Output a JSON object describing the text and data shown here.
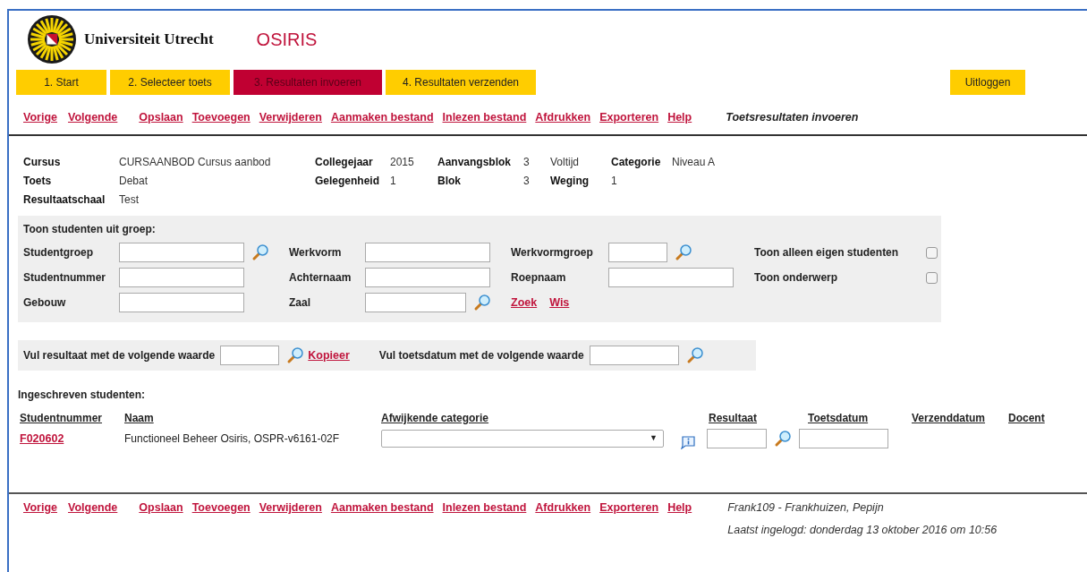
{
  "header": {
    "university": "Universiteit Utrecht",
    "app": "OSIRIS"
  },
  "steps": [
    {
      "label": "1. Start",
      "selected": false
    },
    {
      "label": "2. Selecteer toets",
      "selected": false
    },
    {
      "label": "3. Resultaten invoeren",
      "selected": true
    },
    {
      "label": "4. Resultaten verzenden",
      "selected": false
    }
  ],
  "logout": "Uitloggen",
  "toolbar": {
    "nav": [
      "Vorige",
      "Volgende"
    ],
    "actions": [
      "Opslaan",
      "Toevoegen",
      "Verwijderen",
      "Aanmaken bestand",
      "Inlezen bestand",
      "Afdrukken",
      "Exporteren",
      "Help"
    ],
    "page_title": "Toetsresultaten invoeren"
  },
  "info": [
    [
      {
        "kind": "label",
        "text": "Cursus"
      },
      {
        "kind": "value",
        "text": "CURSAANBOD Cursus aanbod"
      },
      {
        "kind": "label",
        "text": "Collegejaar"
      },
      {
        "kind": "value",
        "text": "2015"
      },
      {
        "kind": "label",
        "text": "Aanvangsblok"
      },
      {
        "kind": "value",
        "text": "3"
      },
      {
        "kind": "value",
        "text": "Voltijd"
      },
      {
        "kind": "label",
        "text": "Categorie"
      },
      {
        "kind": "value",
        "text": "Niveau A"
      }
    ],
    [
      {
        "kind": "label",
        "text": "Toets"
      },
      {
        "kind": "value",
        "text": "Debat"
      },
      {
        "kind": "label",
        "text": "Gelegenheid"
      },
      {
        "kind": "value",
        "text": "1"
      },
      {
        "kind": "label",
        "text": "Blok"
      },
      {
        "kind": "value",
        "text": "3"
      },
      {
        "kind": "label",
        "text": "Weging"
      },
      {
        "kind": "value",
        "text": "1"
      }
    ],
    [
      {
        "kind": "label",
        "text": "Resultaatschaal"
      },
      {
        "kind": "value",
        "text": "Test"
      }
    ]
  ],
  "filter": {
    "title": "Toon studenten uit groep:",
    "rows": [
      [
        {
          "label": "Studentgroep",
          "lookup": true
        },
        {
          "label": "Werkvorm",
          "lookup": false
        },
        {
          "label": "Werkvormgroep",
          "lookup": true
        }
      ],
      [
        {
          "label": "Studentnummer",
          "lookup": false
        },
        {
          "label": "Achternaam",
          "lookup": false
        },
        {
          "label": "Roepnaam",
          "lookup": false
        }
      ],
      [
        {
          "label": "Gebouw",
          "lookup": false
        },
        {
          "label": "Zaal",
          "lookup": true
        }
      ]
    ],
    "options": [
      {
        "label": "Toon alleen eigen studenten",
        "checked": false
      },
      {
        "label": "Toon onderwerp",
        "checked": false
      }
    ],
    "links": [
      "Zoek",
      "Wis"
    ]
  },
  "fill": {
    "result_label": "Vul resultaat met de volgende waarde",
    "copy": "Kopieer",
    "date_label": "Vul toetsdatum met de volgende waarde"
  },
  "students": {
    "title": "Ingeschreven studenten:",
    "columns": [
      "Studentnummer",
      "Naam",
      "Afwijkende categorie",
      "Resultaat",
      "Toetsdatum",
      "Verzenddatum",
      "Docent"
    ],
    "dropdown_arrow": "▼",
    "rows": [
      {
        "number": "F020602",
        "name": "Functioneel Beheer Osiris, OSPR-v6161-02F"
      }
    ]
  },
  "footer": {
    "nav": [
      "Vorige",
      "Volgende"
    ],
    "actions": [
      "Opslaan",
      "Toevoegen",
      "Verwijderen",
      "Aanmaken bestand",
      "Inlezen bestand",
      "Afdrukken",
      "Exporteren",
      "Help"
    ],
    "user": "Frank109 - Frankhuizen, Pepijn",
    "last_login": "Laatst ingelogd: donderdag 13 oktober 2016 om 10:56"
  }
}
